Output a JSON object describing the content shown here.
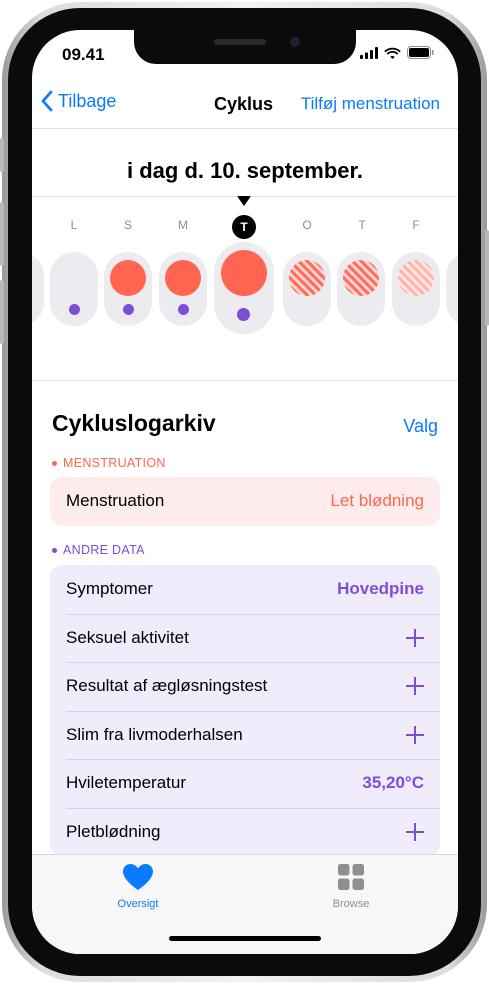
{
  "status": {
    "time": "09.41"
  },
  "nav": {
    "back_label": "Tilbage",
    "title": "Cyklus",
    "action_label": "Tilføj menstruation"
  },
  "date_heading": "i dag d. 10. september.",
  "days": {
    "letters": [
      "L",
      "S",
      "M",
      "T",
      "O",
      "T",
      "F"
    ],
    "today_letter": "T"
  },
  "log": {
    "title": "Cykluslogarkiv",
    "options_label": "Valg",
    "menstruation_section": "MENSTRUATION",
    "menstruation_row": {
      "label": "Menstruation",
      "value": "Let blødning"
    },
    "other_section": "ANDRE DATA",
    "other_rows": [
      {
        "label": "Symptomer",
        "value": "Hovedpine"
      },
      {
        "label": "Seksuel aktivitet",
        "value": ""
      },
      {
        "label": "Resultat af ægløsningstest",
        "value": ""
      },
      {
        "label": "Slim fra livmoderhalsen",
        "value": ""
      },
      {
        "label": "Hviletemperatur",
        "value": "35,20°C"
      },
      {
        "label": "Pletblødning",
        "value": ""
      }
    ]
  },
  "tabs": [
    {
      "label": "Oversigt",
      "icon": "heart-icon",
      "color": "#0a7aff"
    },
    {
      "label": "Browse",
      "icon": "grid-icon",
      "color": "#8e8e93"
    }
  ],
  "colors": {
    "accent": "#0a7aff",
    "menstruation": "#ff6550",
    "other_data": "#7d4dd8",
    "menstruation_bg": "#fdeceb",
    "other_bg": "#efecfb"
  }
}
